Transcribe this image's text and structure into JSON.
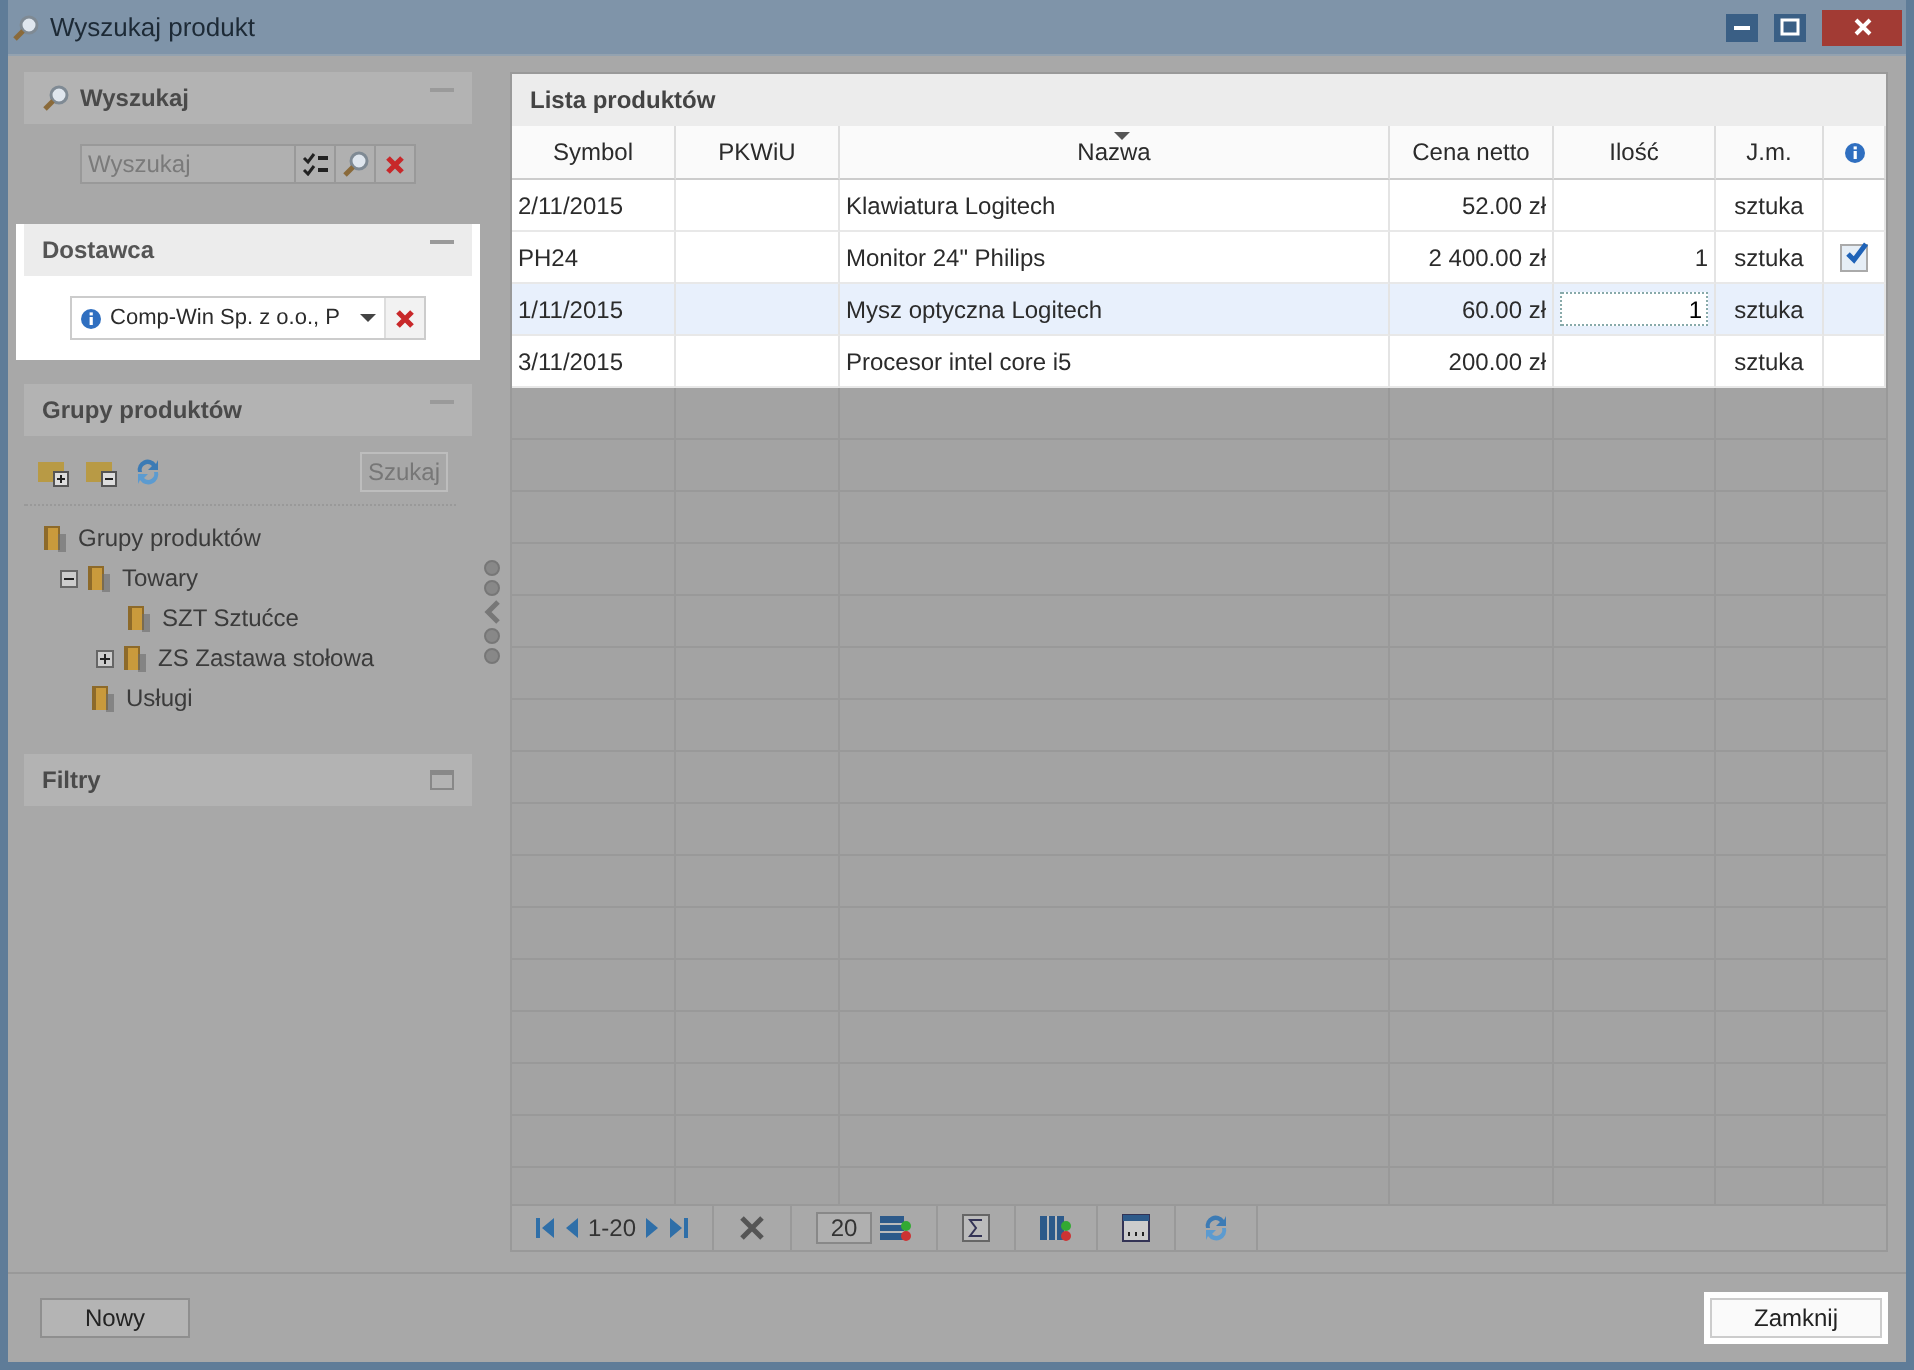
{
  "window": {
    "title": "Wyszukaj produkt"
  },
  "search_panel": {
    "title": "Wyszukaj",
    "placeholder": "Wyszukaj"
  },
  "supplier_panel": {
    "title": "Dostawca",
    "value": "Comp-Win Sp. z o.o., P"
  },
  "groups_panel": {
    "title": "Grupy produktów",
    "search_button": "Szukaj",
    "tree": [
      {
        "label": "Grupy produktów",
        "kind": "root",
        "children": [
          {
            "label": "Towary",
            "kind": "branch",
            "expanded": true,
            "children": [
              {
                "label": "SZT Sztućce",
                "kind": "leaf"
              },
              {
                "label": "ZS Zastawa stołowa",
                "kind": "branch",
                "expanded": false
              }
            ]
          },
          {
            "label": "Usługi",
            "kind": "leaf"
          }
        ]
      }
    ]
  },
  "filters_panel": {
    "title": "Filtry"
  },
  "product_list": {
    "title": "Lista produktów",
    "columns": [
      "Symbol",
      "PKWiU",
      "Nazwa",
      "Cena netto",
      "Ilość",
      "J.m."
    ],
    "rows": [
      {
        "symbol": "2/11/2015",
        "name": "Klawiatura Logitech",
        "price": "52.00 zł",
        "unit": "sztuka",
        "checked": false,
        "selected": false
      },
      {
        "symbol": "PH24",
        "name": "Monitor 24\" Philips",
        "price": "2 400.00 zł",
        "quantity": "1",
        "unit": "sztuka",
        "checked": true,
        "selected": false
      },
      {
        "symbol": "1/11/2015",
        "name": "Mysz optyczna Logitech",
        "price": "60.00 zł",
        "quantity": "1",
        "editing": true,
        "unit": "sztuka",
        "checked": false,
        "selected": true
      },
      {
        "symbol": "3/11/2015",
        "name": "Procesor intel core i5",
        "price": "200.00 zł",
        "unit": "sztuka",
        "checked": false,
        "selected": false
      }
    ],
    "pager": {
      "range": "1-20",
      "page_size": "20"
    }
  },
  "buttons": {
    "new": "Nowy",
    "close": "Zamknij"
  }
}
